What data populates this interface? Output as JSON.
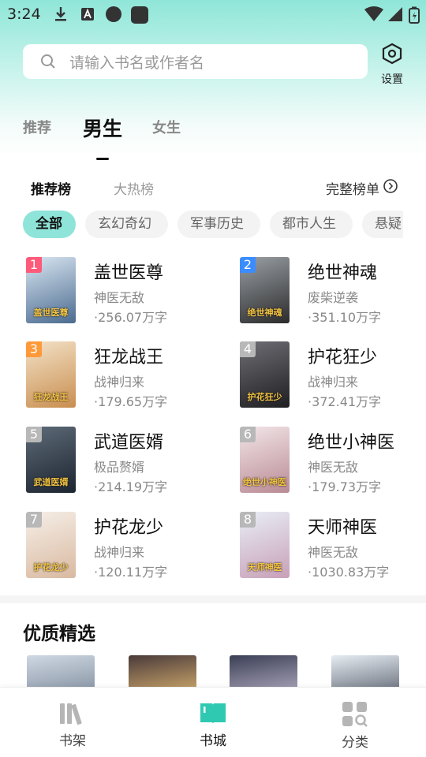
{
  "status_bar": {
    "time": "3:24"
  },
  "search": {
    "placeholder": "请输入书名或作者名"
  },
  "settings": {
    "label": "设置"
  },
  "gender_tabs": [
    {
      "label": "推荐"
    },
    {
      "label": "男生",
      "active": true
    },
    {
      "label": "女生"
    }
  ],
  "rank_tabs": [
    {
      "label": "推荐榜",
      "active": true
    },
    {
      "label": "大热榜"
    }
  ],
  "full_list_label": "完整榜单",
  "categories": [
    {
      "label": "全部",
      "active": true
    },
    {
      "label": "玄幻奇幻"
    },
    {
      "label": "军事历史"
    },
    {
      "label": "都市人生"
    },
    {
      "label": "悬疑"
    }
  ],
  "books": [
    {
      "rank": "1",
      "title": "盖世医尊",
      "tag": "神医无敌",
      "words": "·256.07万字",
      "cover_text": "盖世医尊",
      "badge_color": "#ff5a7a",
      "cover_colors": [
        "#d9e6f2",
        "#4b6b8f"
      ]
    },
    {
      "rank": "2",
      "title": "绝世神魂",
      "tag": "废柴逆袭",
      "words": "·351.10万字",
      "cover_text": "绝世神魂",
      "badge_color": "#3a8cff",
      "cover_colors": [
        "#9aa0a6",
        "#2b2b2b"
      ]
    },
    {
      "rank": "3",
      "title": "狂龙战王",
      "tag": "战神归来",
      "words": "·179.65万字",
      "cover_text": "狂龙战王",
      "badge_color": "#ff9a3a",
      "cover_colors": [
        "#f3e2c8",
        "#c98e4f"
      ]
    },
    {
      "rank": "4",
      "title": "护花狂少",
      "tag": "战神归来",
      "words": "·372.41万字",
      "cover_text": "护花狂少",
      "badge_color": "#b8b8b8",
      "cover_colors": [
        "#6e6e74",
        "#1f1f22"
      ]
    },
    {
      "rank": "5",
      "title": "武道医婿",
      "tag": "极品赘婿",
      "words": "·214.19万字",
      "cover_text": "武道医婿",
      "badge_color": "#b8b8b8",
      "cover_colors": [
        "#5e6b78",
        "#1c2430"
      ]
    },
    {
      "rank": "6",
      "title": "绝世小神医",
      "tag": "神医无敌",
      "words": "·179.73万字",
      "cover_text": "绝世小神医",
      "badge_color": "#b8b8b8",
      "cover_colors": [
        "#f2e6e8",
        "#b98a94"
      ]
    },
    {
      "rank": "7",
      "title": "护花龙少",
      "tag": "战神归来",
      "words": "·120.11万字",
      "cover_text": "护花龙少",
      "badge_color": "#b8b8b8",
      "cover_colors": [
        "#f6efe8",
        "#d9b9a0"
      ]
    },
    {
      "rank": "8",
      "title": "天师神医",
      "tag": "神医无敌",
      "words": "·1030.83万字",
      "cover_text": "天师神医",
      "badge_color": "#b8b8b8",
      "cover_colors": [
        "#e8eef6",
        "#c8a0b8"
      ]
    }
  ],
  "section": {
    "title": "优质精选"
  },
  "premium_covers": [
    {
      "colors": [
        "#cfd8e3",
        "#8a96a6"
      ]
    },
    {
      "colors": [
        "#4a3a3a",
        "#c9a56a"
      ]
    },
    {
      "colors": [
        "#3a3f55",
        "#a8a2b8"
      ]
    },
    {
      "colors": [
        "#e6ecf2",
        "#6d7480"
      ]
    }
  ],
  "bottom_nav": [
    {
      "label": "书架"
    },
    {
      "label": "书城",
      "active": true
    },
    {
      "label": "分类"
    }
  ],
  "colors": {
    "accent": "#2fc9b2",
    "accent_light": "#8ee4d8"
  }
}
